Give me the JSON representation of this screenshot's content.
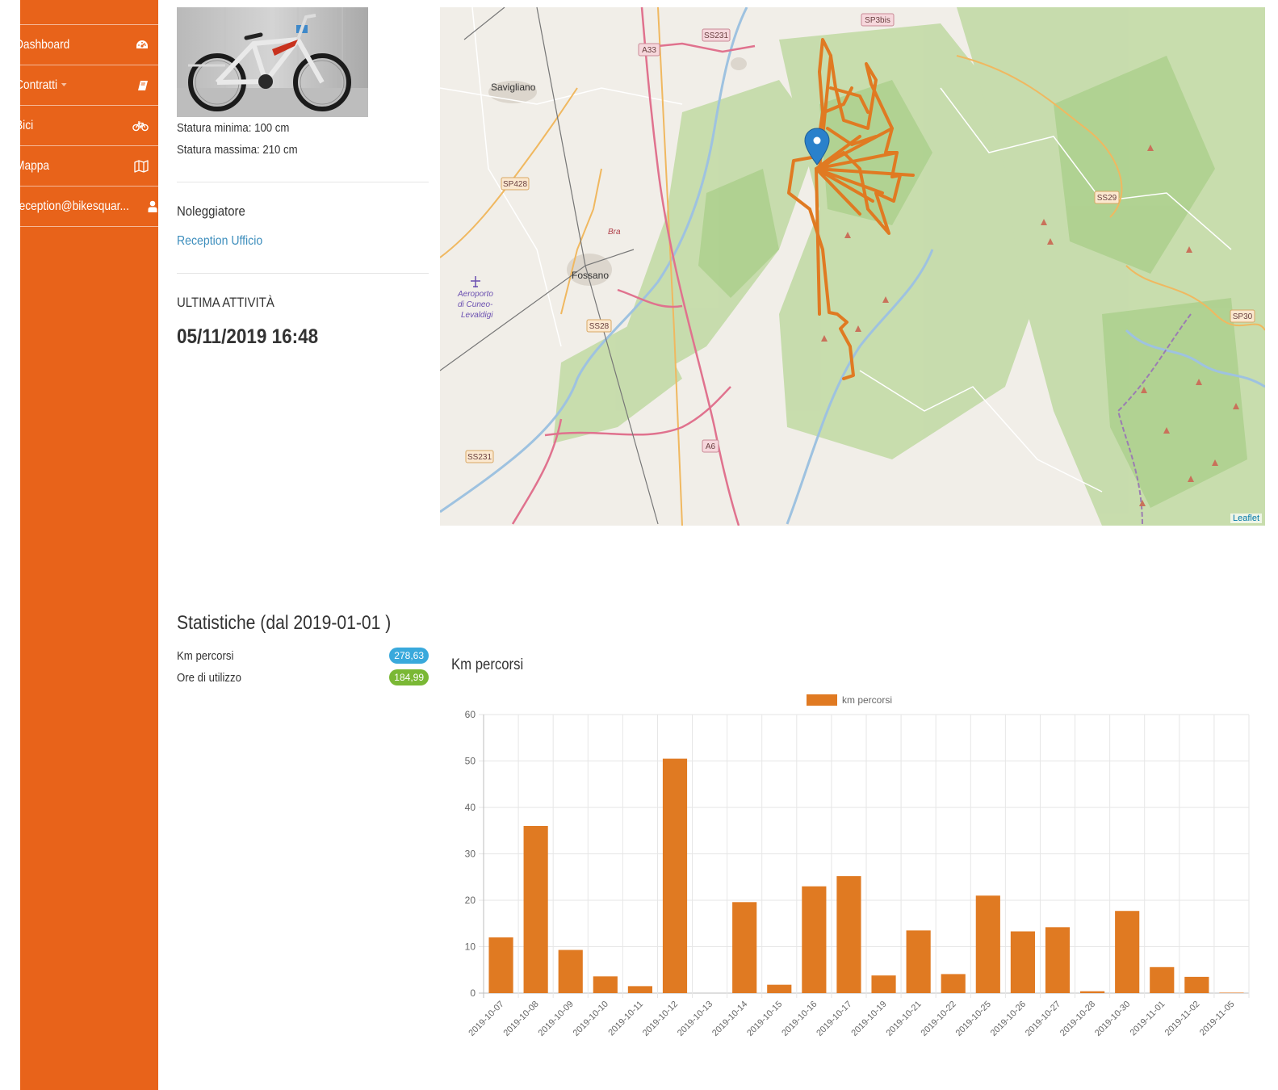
{
  "sidebar": {
    "items": [
      {
        "label": "Dashboard",
        "icon": "dashboard-icon"
      },
      {
        "label": "Contratti",
        "icon": "book-icon",
        "has_caret": true
      },
      {
        "label": "Bici",
        "icon": "bicycle-icon"
      },
      {
        "label": "Mappa",
        "icon": "map-icon"
      },
      {
        "label": "reception@bikesquar...",
        "icon": "user-icon"
      }
    ]
  },
  "bike": {
    "min_height": "Statura minima: 100 cm",
    "max_height": "Statura massima: 210 cm"
  },
  "renter": {
    "heading": "Noleggiatore",
    "name": "Reception Ufficio"
  },
  "last_activity": {
    "heading": "ULTIMA ATTIVITÀ",
    "datetime": "05/11/2019 16:48"
  },
  "map": {
    "attribution": "Leaflet",
    "places": [
      "Savigliano",
      "Fossano",
      "Bra",
      "Aeroporto",
      "di Cuneo-",
      "Levaldigi"
    ],
    "road_labels": [
      "SS231",
      "A33",
      "SP3bis",
      "SP428",
      "SS29",
      "SS28",
      "SP30",
      "A6",
      "SS231"
    ],
    "track_color": "#e07a22",
    "marker_color": "#2a81cb"
  },
  "stats": {
    "title": "Statistiche (dal 2019-01-01 )",
    "rows": [
      {
        "label": "Km percorsi",
        "value": "278,63",
        "color": "#39a9dc"
      },
      {
        "label": "Ore di utilizzo",
        "value": "184,99",
        "color": "#7ab835"
      }
    ]
  },
  "chart_title": "Km percorsi",
  "chart_data": {
    "type": "bar",
    "title": "Km percorsi",
    "legend": "top",
    "grid": true,
    "ylim": [
      0,
      60
    ],
    "yticks": [
      0,
      10,
      20,
      30,
      40,
      50,
      60
    ],
    "color": "#e07a22",
    "categories": [
      "2019-10-07",
      "2019-10-08",
      "2019-10-09",
      "2019-10-10",
      "2019-10-11",
      "2019-10-12",
      "2019-10-13",
      "2019-10-14",
      "2019-10-15",
      "2019-10-16",
      "2019-10-17",
      "2019-10-19",
      "2019-10-21",
      "2019-10-22",
      "2019-10-25",
      "2019-10-26",
      "2019-10-27",
      "2019-10-28",
      "2019-10-30",
      "2019-11-01",
      "2019-11-02",
      "2019-11-05"
    ],
    "series": [
      {
        "name": "km percorsi",
        "values": [
          12.0,
          36.0,
          9.3,
          3.6,
          1.5,
          50.5,
          0,
          19.6,
          1.8,
          23.0,
          25.2,
          3.8,
          13.5,
          4.1,
          21.0,
          13.3,
          14.2,
          0.4,
          17.7,
          5.6,
          3.5,
          0.1
        ]
      }
    ]
  }
}
